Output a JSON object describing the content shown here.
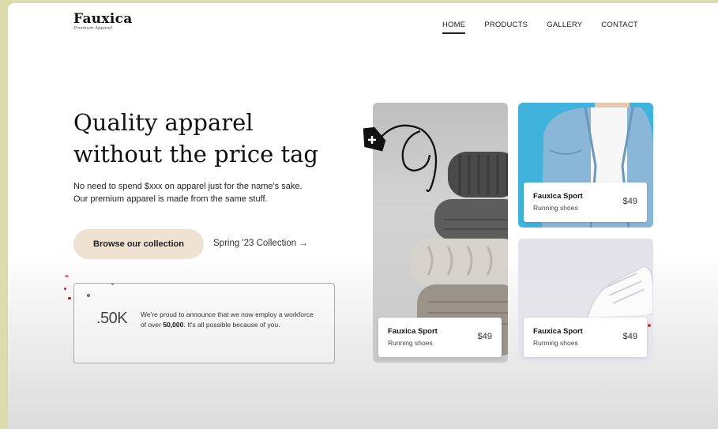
{
  "brand": {
    "name": "Fauxica",
    "tagline": "Premium Apparel"
  },
  "nav": [
    {
      "label": "HOME",
      "active": true
    },
    {
      "label": "PRODUCTS",
      "active": false
    },
    {
      "label": "GALLERY",
      "active": false
    },
    {
      "label": "CONTACT",
      "active": false
    }
  ],
  "hero": {
    "title_line1": "Quality apparel",
    "title_line2": "without the price tag",
    "sub_line1": "No need to spend $xxx on apparel just for the name's sake.",
    "sub_line2": "Our premium apparel is made from the same stuff.",
    "cta_label": "Browse our collection",
    "secondary_link": "Spring '23 Collection →"
  },
  "stat": {
    "number": ".50K",
    "text_before": "We're proud to announce that we now employ a workforce of over ",
    "text_bold": "50,000",
    "text_after": ". It's all possible because of you."
  },
  "products": [
    {
      "name": "Fauxica Sport",
      "subtitle": "Running shoes",
      "price": "$49",
      "image": "folded-sweaters"
    },
    {
      "name": "Fauxica Sport",
      "subtitle": "Running shoes",
      "price": "$49",
      "image": "denim-jacket"
    },
    {
      "name": "Fauxica Sport",
      "subtitle": "Running shoes",
      "price": "$49",
      "image": "white-sneaker"
    }
  ],
  "colors": {
    "cta_bg": "#f0e2d3",
    "outer_bg": "#d9dcaa",
    "denim_bg": "#3fb3dc"
  },
  "icons": {
    "doodle": "price-tag-plus-icon"
  }
}
